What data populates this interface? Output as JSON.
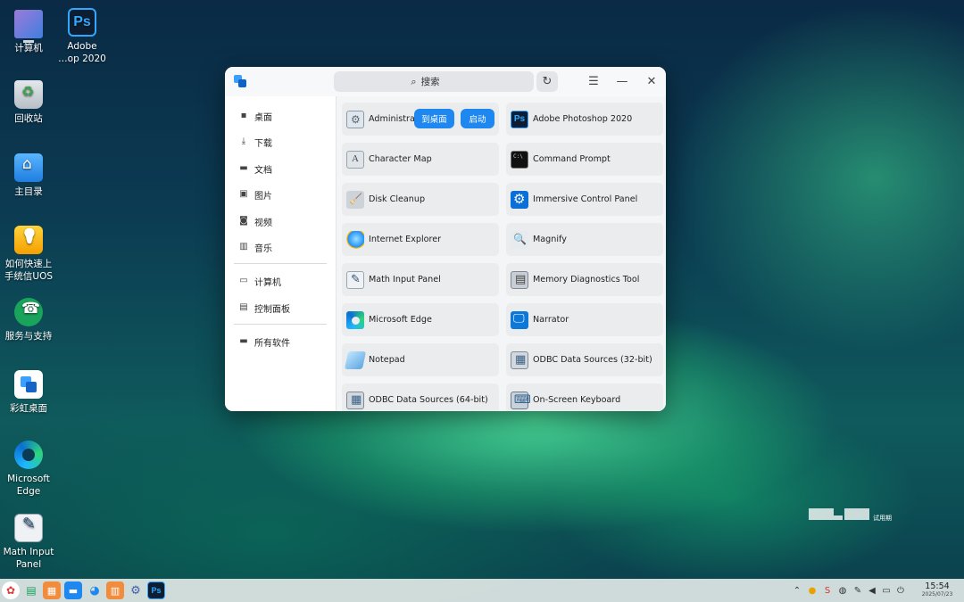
{
  "desktop": {
    "icons": [
      {
        "label": "计算机"
      },
      {
        "label": "Adobe\n…op 2020"
      },
      {
        "label": "回收站"
      },
      {
        "label": "主目录"
      },
      {
        "label": "如何快速上\n手统信UOS"
      },
      {
        "label": "服务与支持"
      },
      {
        "label": "彩虹桌面"
      },
      {
        "label": "Microsoft\nEdge"
      },
      {
        "label": "Math Input\nPanel"
      }
    ]
  },
  "window": {
    "search_placeholder": "搜索",
    "sidebar": {
      "items": [
        {
          "label": "桌面",
          "icon": "grid-icon"
        },
        {
          "label": "下载",
          "icon": "download-icon"
        },
        {
          "label": "文档",
          "icon": "folder-icon"
        },
        {
          "label": "图片",
          "icon": "image-icon"
        },
        {
          "label": "视频",
          "icon": "gamepad-icon"
        },
        {
          "label": "音乐",
          "icon": "music-icon"
        },
        {
          "label": "计算机",
          "icon": "monitor-icon"
        },
        {
          "label": "控制面板",
          "icon": "control-panel-icon"
        },
        {
          "label": "所有软件",
          "icon": "folder-icon"
        }
      ]
    },
    "apps": [
      {
        "name": "Administrati",
        "icon": "admin-tools-icon"
      },
      {
        "name": "Adobe Photoshop 2020",
        "icon": "photoshop-icon"
      },
      {
        "name": "Character Map",
        "icon": "character-map-icon"
      },
      {
        "name": "Command Prompt",
        "icon": "cmd-icon"
      },
      {
        "name": "Disk Cleanup",
        "icon": "disk-cleanup-icon"
      },
      {
        "name": "Immersive Control Panel",
        "icon": "settings-icon"
      },
      {
        "name": "Internet Explorer",
        "icon": "ie-icon"
      },
      {
        "name": "Magnify",
        "icon": "magnify-icon"
      },
      {
        "name": "Math Input Panel",
        "icon": "math-input-icon"
      },
      {
        "name": "Memory Diagnostics Tool",
        "icon": "memory-icon"
      },
      {
        "name": "Microsoft Edge",
        "icon": "edge-icon"
      },
      {
        "name": "Narrator",
        "icon": "narrator-icon"
      },
      {
        "name": "Notepad",
        "icon": "notepad-icon"
      },
      {
        "name": "ODBC Data Sources (32-bit)",
        "icon": "odbc-icon"
      },
      {
        "name": "ODBC Data Sources (64-bit)",
        "icon": "odbc-icon"
      },
      {
        "name": "On-Screen Keyboard",
        "icon": "keyboard-icon"
      }
    ],
    "hover_actions": {
      "to_desktop": "到桌面",
      "launch": "启动"
    }
  },
  "watermark": {
    "text": "试用期"
  },
  "taskbar": {
    "time": "15:54",
    "date": "2025/07/23"
  },
  "colors": {
    "accent": "#1f87f0",
    "window_bg": "#f4f5f7",
    "tile_bg": "#ebecee"
  }
}
